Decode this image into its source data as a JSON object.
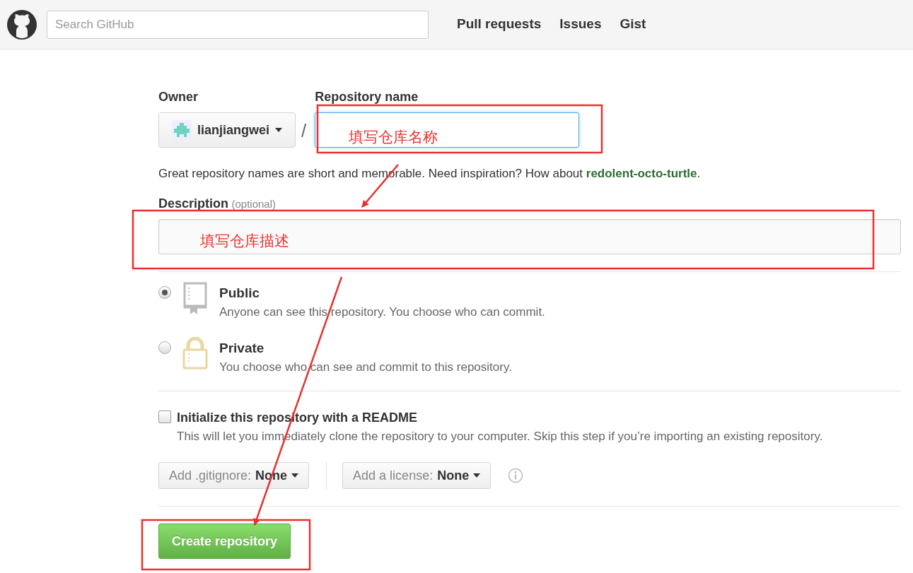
{
  "header": {
    "search_placeholder": "Search GitHub",
    "nav": [
      "Pull requests",
      "Issues",
      "Gist"
    ]
  },
  "owner": {
    "label": "Owner",
    "value": "lianjiangwei"
  },
  "repo_name": {
    "label": "Repository name"
  },
  "separator": "/",
  "hint": {
    "text": "Great repository names are short and memorable. Need inspiration? How about ",
    "suggestion": "redolent-octo-turtle",
    "end": "."
  },
  "description": {
    "label": "Description",
    "optional": "(optional)"
  },
  "visibility": [
    {
      "kind": "public",
      "title": "Public",
      "text": "Anyone can see this repository. You choose who can commit.",
      "selected": true
    },
    {
      "kind": "private",
      "title": "Private",
      "text": "You choose who can see and commit to this repository.",
      "selected": false
    }
  ],
  "readme": {
    "label": "Initialize this repository with a README",
    "text": "This will let you immediately clone the repository to your computer. Skip this step if you’re importing an existing repository.",
    "checked": false
  },
  "gitignore": {
    "label": "Add .gitignore:",
    "value": "None"
  },
  "license": {
    "label": "Add a license:",
    "value": "None"
  },
  "create_button": "Create repository",
  "annotations": [
    {
      "text": "填写仓库名称"
    },
    {
      "text": "填写仓库描述"
    }
  ]
}
